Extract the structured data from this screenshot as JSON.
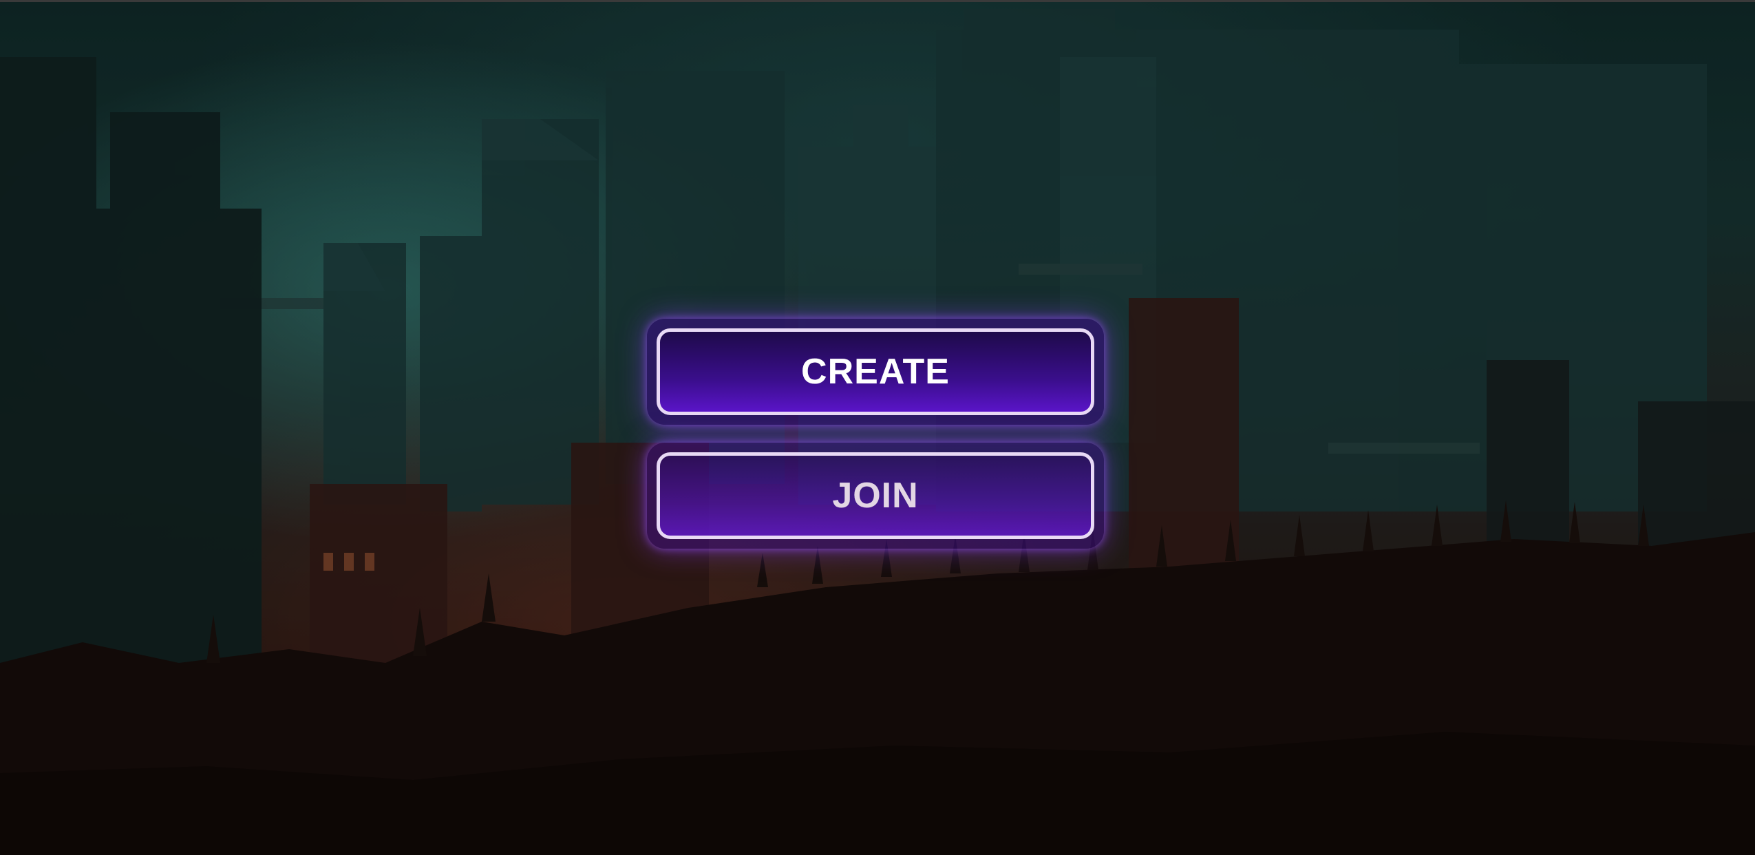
{
  "menu": {
    "create_label": "CREATE",
    "join_label": "JOIN"
  },
  "colors": {
    "button_fill": "#3a0e8c",
    "button_border": "#e8d9f5",
    "glow": "#8c3cff",
    "sky_teal": "#1a3a38",
    "ground_rust": "#2a1812"
  },
  "background": {
    "icon": "gothic-city-illustration"
  }
}
